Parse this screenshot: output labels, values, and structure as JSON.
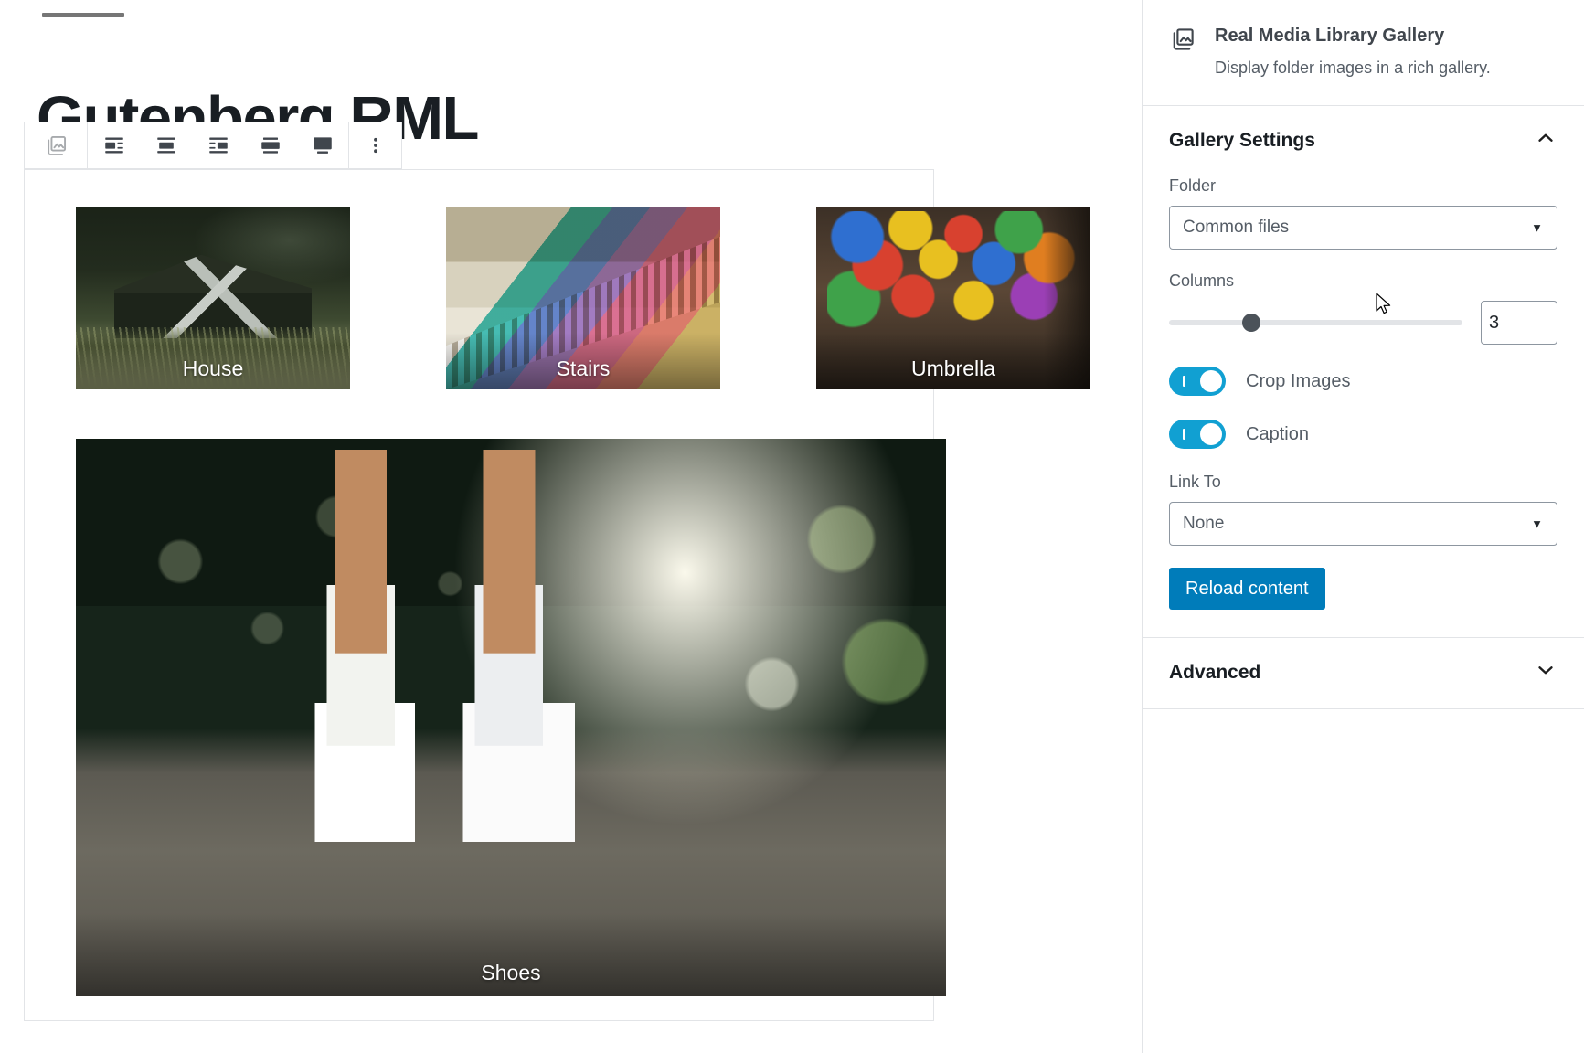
{
  "editor": {
    "post_title": "Gutenberg RML",
    "toolbar": {
      "block_type_icon": "gallery-icon",
      "buttons": [
        {
          "name": "align-left-button",
          "icon": "align-left-icon",
          "label": "Align left"
        },
        {
          "name": "align-center-button",
          "icon": "align-center-icon",
          "label": "Align center"
        },
        {
          "name": "align-right-button",
          "icon": "align-right-icon",
          "label": "Align right"
        },
        {
          "name": "align-wide-button",
          "icon": "align-wide-icon",
          "label": "Wide width"
        },
        {
          "name": "align-full-button",
          "icon": "align-full-icon",
          "label": "Full width"
        }
      ],
      "more_options_label": "More options"
    },
    "gallery": {
      "rows": [
        [
          {
            "caption": "House",
            "art": "ph-house",
            "size": "small"
          },
          {
            "caption": "Stairs",
            "art": "ph-stairs",
            "size": "small"
          },
          {
            "caption": "Umbrella",
            "art": "ph-umbrella",
            "size": "small"
          }
        ],
        [
          {
            "caption": "Shoes",
            "art": "ph-shoes",
            "size": "big"
          }
        ]
      ]
    }
  },
  "sidebar": {
    "block_card": {
      "icon": "gallery-icon",
      "title": "Real Media Library Gallery",
      "description": "Display folder images in a rich gallery."
    },
    "gallery_settings": {
      "title": "Gallery Settings",
      "expanded": true,
      "toggle_icon": "chevron-up-icon",
      "folder": {
        "label": "Folder",
        "value": "Common files",
        "caret_icon": "chevron-down-icon"
      },
      "columns": {
        "label": "Columns",
        "value": "3",
        "min": 1,
        "max": 8,
        "percent": 28
      },
      "crop_images": {
        "label": "Crop Images",
        "checked": true
      },
      "caption": {
        "label": "Caption",
        "checked": true
      },
      "link_to": {
        "label": "Link To",
        "value": "None",
        "caret_icon": "chevron-down-icon"
      },
      "reload_button": {
        "label": "Reload content",
        "color": "#007cba"
      }
    },
    "advanced": {
      "title": "Advanced",
      "expanded": false,
      "toggle_icon": "chevron-down-icon"
    }
  },
  "colors": {
    "accent_blue": "#007cba",
    "toggle_on": "#11a0d2",
    "border": "#e2e4e7",
    "text_muted": "#555d66",
    "text_dark": "#191e23"
  }
}
